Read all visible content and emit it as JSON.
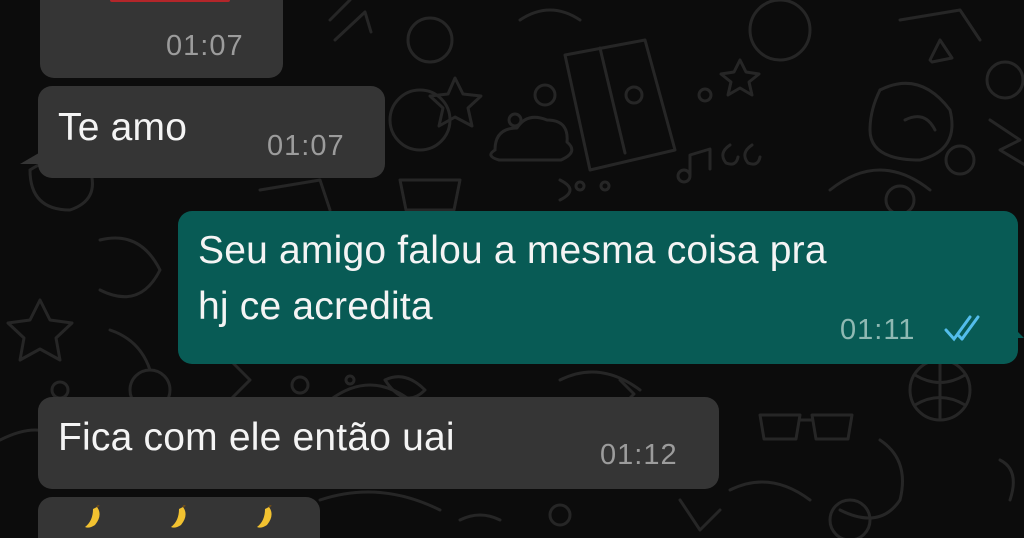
{
  "messages": [
    {
      "id": "m1",
      "direction": "incoming",
      "text": "",
      "time": "01:07"
    },
    {
      "id": "m2",
      "direction": "incoming",
      "text": "Te amo",
      "time": "01:07"
    },
    {
      "id": "m3",
      "direction": "outgoing",
      "text": "Seu amigo falou a mesma coisa pra\nhj ce acredita",
      "time": "01:11",
      "status": "read"
    },
    {
      "id": "m4",
      "direction": "incoming",
      "text": "Fica com ele então uai",
      "time": "01:12"
    },
    {
      "id": "m5",
      "direction": "incoming",
      "emoji": [
        "banana",
        "banana",
        "banana"
      ]
    }
  ],
  "colors": {
    "background": "#0c0c0c",
    "incoming_bubble": "#353535",
    "outgoing_bubble": "#085b55",
    "read_ticks": "#53bdeb",
    "emoji": "#f2c230"
  }
}
